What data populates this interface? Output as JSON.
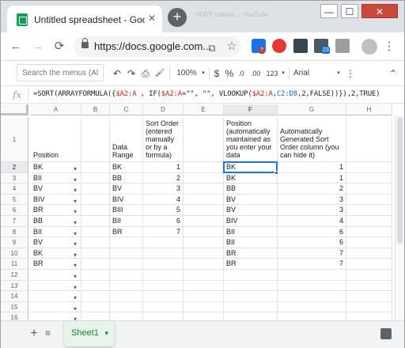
{
  "browser": {
    "tab_title": "Untitled spreadsheet - Google Sh",
    "tab_close": "✕",
    "new_tab": "+",
    "ghost_tab": "SORT column ... YouTube",
    "url": "https://docs.google.com...",
    "window_min": "—",
    "window_max": "☐",
    "window_close": "✕",
    "nav_back": "←",
    "nav_forward": "→",
    "nav_reload": "⟳",
    "share": "⧉",
    "bookmark": "☆",
    "ext_badges": [
      "?",
      "",
      "",
      "23",
      ""
    ],
    "menu": "⋮"
  },
  "toolbar": {
    "search_placeholder": "Search the menus (Alt+/)",
    "undo": "↶",
    "redo": "↷",
    "print": "⎙",
    "paint": "🖌",
    "zoom": "100%",
    "currency": "$",
    "percent": "%",
    "dec_less": ".0",
    "dec_more": ".00",
    "format": "123",
    "font": "Arial",
    "more": "⋮",
    "collapse": "⌃"
  },
  "formula_bar": {
    "fx": "fx",
    "parts": [
      {
        "t": "=SORT(ARRAYFORMULA({",
        "c": ""
      },
      {
        "t": "$A2:A",
        "c": "fr"
      },
      {
        "t": " , IF(",
        "c": ""
      },
      {
        "t": "$A2:A",
        "c": "fr"
      },
      {
        "t": "=\"\", \"\", VLOOKUP(",
        "c": ""
      },
      {
        "t": "$A2:A",
        "c": "fr"
      },
      {
        "t": ",",
        "c": ""
      },
      {
        "t": "C2:D8",
        "c": "fp"
      },
      {
        "t": ",2,FALSE)",
        "c": ""
      },
      {
        "t": ")}),2,TRUE)",
        "c": ""
      }
    ]
  },
  "grid": {
    "columns": [
      "A",
      "B",
      "C",
      "D",
      "E",
      "F",
      "G",
      "H"
    ],
    "selected_column": "F",
    "selected_row": "2",
    "header_row": {
      "row_label": "1",
      "A": "Position",
      "B": "",
      "C": "Data Range",
      "D": "Sort Order (entered manually or by a formula)",
      "E": "",
      "F": "Automatically Sorted Position (automatically maintained as you enter your data",
      "G": "Automatically Generated Sort Order column (you can hide it)",
      "H": ""
    },
    "rows": [
      {
        "r": "2",
        "A": "BK",
        "C": "BK",
        "D": "1",
        "F": "BK",
        "G": "1"
      },
      {
        "r": "3",
        "A": "BII",
        "C": "BB",
        "D": "2",
        "F": "BK",
        "G": "1"
      },
      {
        "r": "4",
        "A": "BV",
        "C": "BV",
        "D": "3",
        "F": "BB",
        "G": "2"
      },
      {
        "r": "5",
        "A": "BIV",
        "C": "BIV",
        "D": "4",
        "F": "BV",
        "G": "3"
      },
      {
        "r": "6",
        "A": "BR",
        "C": "BIII",
        "D": "5",
        "F": "BV",
        "G": "3"
      },
      {
        "r": "7",
        "A": "BB",
        "C": "BII",
        "D": "6",
        "F": "BIV",
        "G": "4"
      },
      {
        "r": "8",
        "A": "BII",
        "C": "BR",
        "D": "7",
        "F": "BII",
        "G": "6"
      },
      {
        "r": "9",
        "A": "BV",
        "C": "",
        "D": "",
        "F": "BII",
        "G": "6"
      },
      {
        "r": "10",
        "A": "BK",
        "C": "",
        "D": "",
        "F": "BR",
        "G": "7"
      },
      {
        "r": "11",
        "A": "BR",
        "C": "",
        "D": "",
        "F": "BR",
        "G": "7"
      },
      {
        "r": "12",
        "A": "",
        "C": "",
        "D": "",
        "F": "",
        "G": ""
      },
      {
        "r": "13",
        "A": "",
        "C": "",
        "D": "",
        "F": "",
        "G": ""
      },
      {
        "r": "14",
        "A": "",
        "C": "",
        "D": "",
        "F": "",
        "G": ""
      },
      {
        "r": "15",
        "A": "",
        "C": "",
        "D": "",
        "F": "",
        "G": ""
      },
      {
        "r": "16",
        "A": "",
        "C": "",
        "D": "",
        "F": "",
        "G": ""
      },
      {
        "r": "17",
        "A": "",
        "C": "",
        "D": "",
        "F": "",
        "G": ""
      }
    ]
  },
  "sheets": {
    "add": "+",
    "all": "≡",
    "active": "Sheet1"
  }
}
